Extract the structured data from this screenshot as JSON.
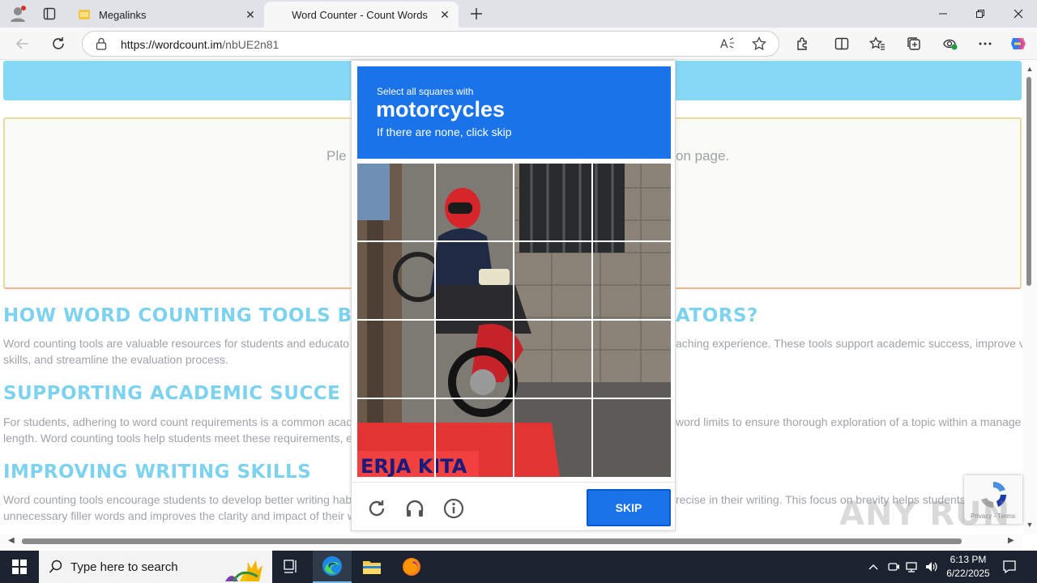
{
  "browser": {
    "tabs": [
      {
        "title": "Megalinks",
        "active": false
      },
      {
        "title": "Word Counter - Count Words",
        "active": true
      }
    ],
    "url_host": "https://wordcount.im",
    "url_path": "/nbUE2n81"
  },
  "page": {
    "notice_left": "Ple",
    "notice_right": "on page.",
    "sections": [
      {
        "heading_left": "HOW WORD COUNTING TOOLS B",
        "heading_right": "ATORS?",
        "lines_left": [
          "Word counting tools are valuable resources for students and educato",
          "skills, and streamline the evaluation process."
        ],
        "lines_right": [
          "aching experience. These tools support academic success, improve v",
          ""
        ]
      },
      {
        "heading_left": "SUPPORTING ACADEMIC SUCCE",
        "heading_right": "",
        "lines_left": [
          "For students, adhering to word count requirements is a common acad",
          "length. Word counting tools help students meet these requirements, e"
        ],
        "lines_right": [
          "word limits to ensure thorough exploration of a topic within a manage",
          ""
        ]
      },
      {
        "heading_left": "IMPROVING WRITING SKILLS",
        "heading_right": "",
        "lines_left": [
          "Word counting tools encourage students to develop better writing hab",
          "unnecessary filler words and improves the clarity and impact of their w"
        ],
        "lines_right": [
          "recise in their writing. This focus on brevity helps students",
          ""
        ]
      }
    ]
  },
  "captcha": {
    "instruction": "Select all squares with",
    "target": "motorcycles",
    "hint": "If there are none, click skip",
    "skip_label": "SKIP",
    "grid_cols": 4,
    "grid_rows": 4
  },
  "recaptcha_badge": {
    "text": "Privacy - Terms"
  },
  "watermark": "ANY RUN",
  "taskbar": {
    "search_placeholder": "Type here to search",
    "time": "6:13 PM",
    "date": "6/22/2025"
  },
  "colors": {
    "accent": "#1a73e8",
    "heading": "#7dd2ef",
    "banner": "#85d9f5"
  }
}
